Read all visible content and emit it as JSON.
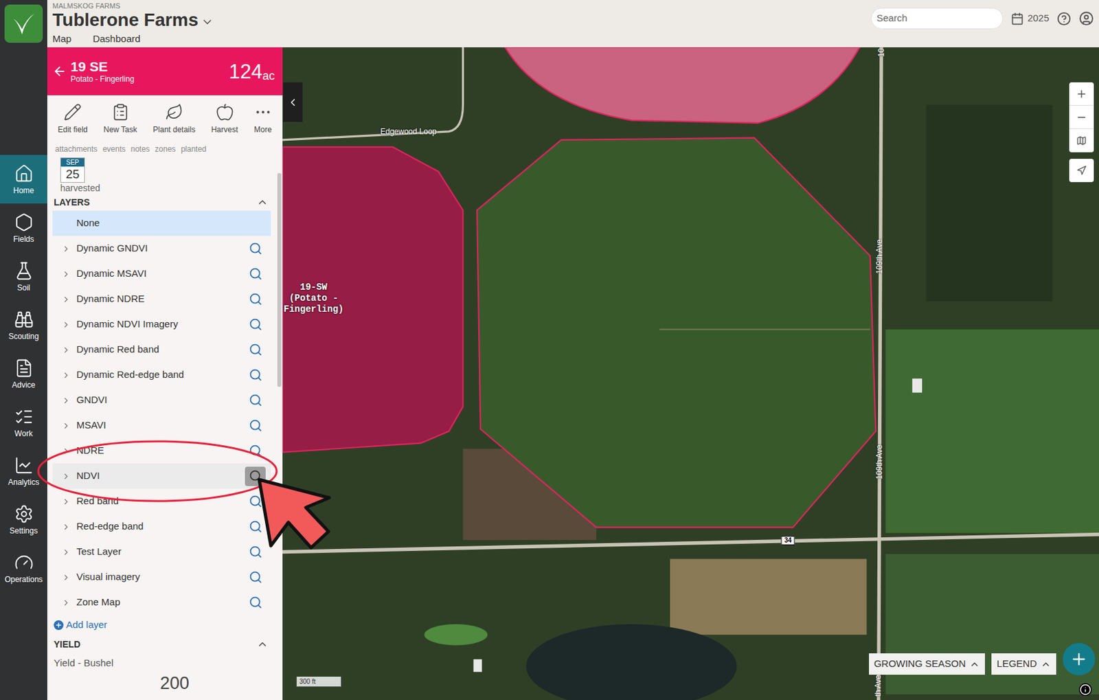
{
  "app": {
    "org": "MALMSKOG FARMS",
    "farm": "Tublerone Farms",
    "tabs": [
      {
        "label": "Map",
        "selected": true
      },
      {
        "label": "Dashboard",
        "selected": false
      }
    ],
    "search": {
      "placeholder": "Search"
    },
    "year": "2025"
  },
  "rail": [
    {
      "label": "Home",
      "selected": true
    },
    {
      "label": "Fields",
      "selected": false
    },
    {
      "label": "Soil",
      "selected": false
    },
    {
      "label": "Scouting",
      "selected": false
    },
    {
      "label": "Advice",
      "selected": false
    },
    {
      "label": "Work",
      "selected": false
    },
    {
      "label": "Analytics",
      "selected": false
    },
    {
      "label": "Settings",
      "selected": false
    },
    {
      "label": "Operations",
      "selected": false
    }
  ],
  "field": {
    "name": "19 SE",
    "crop": "Potato - Fingerling",
    "area": "124",
    "unit": "ac"
  },
  "toolbar": [
    "Edit field",
    "New Task",
    "Plant details",
    "Harvest",
    "More"
  ],
  "sub_tabs": [
    "attachments",
    "events",
    "notes",
    "zones",
    "planted"
  ],
  "harvest": {
    "month": "SEP",
    "day": "25",
    "label": "harvested"
  },
  "layers": {
    "title": "LAYERS",
    "expanded": true,
    "add": "Add layer",
    "items": [
      {
        "label": "None",
        "selected": true,
        "hovered": false,
        "kind": "none"
      },
      {
        "label": "Dynamic GNDVI",
        "selected": false,
        "hovered": false,
        "kind": "layer"
      },
      {
        "label": "Dynamic MSAVI",
        "selected": false,
        "hovered": false,
        "kind": "layer"
      },
      {
        "label": "Dynamic NDRE",
        "selected": false,
        "hovered": false,
        "kind": "layer"
      },
      {
        "label": "Dynamic NDVI Imagery",
        "selected": false,
        "hovered": false,
        "kind": "layer"
      },
      {
        "label": "Dynamic Red band",
        "selected": false,
        "hovered": false,
        "kind": "layer"
      },
      {
        "label": "Dynamic Red-edge band",
        "selected": false,
        "hovered": false,
        "kind": "layer"
      },
      {
        "label": "GNDVI",
        "selected": false,
        "hovered": false,
        "kind": "layer"
      },
      {
        "label": "MSAVI",
        "selected": false,
        "hovered": false,
        "kind": "layer"
      },
      {
        "label": "NDRE",
        "selected": false,
        "hovered": false,
        "kind": "layer"
      },
      {
        "label": "NDVI",
        "selected": false,
        "hovered": true,
        "kind": "layer"
      },
      {
        "label": "Red band",
        "selected": false,
        "hovered": false,
        "kind": "layer"
      },
      {
        "label": "Red-edge band",
        "selected": false,
        "hovered": false,
        "kind": "layer"
      },
      {
        "label": "Test Layer",
        "selected": false,
        "hovered": false,
        "kind": "layer"
      },
      {
        "label": "Visual imagery",
        "selected": false,
        "hovered": false,
        "kind": "layer"
      },
      {
        "label": "Zone Map",
        "selected": false,
        "hovered": false,
        "kind": "layer"
      }
    ]
  },
  "yield": {
    "title": "YIELD",
    "expanded": true,
    "label": "Yield - Bushel",
    "value": "200"
  },
  "map": {
    "field_label": [
      "19-SW",
      "(Potato -",
      "Fingerling)"
    ],
    "road_labels": [
      {
        "text": "Edgewood Loop",
        "kind": "horizontal"
      },
      {
        "text": "10",
        "kind": "vertical"
      },
      {
        "text": "109th Ave",
        "kind": "vertical"
      },
      {
        "text": "109th Ave",
        "kind": "vertical"
      },
      {
        "text": "th Ave",
        "kind": "vertical"
      },
      {
        "text": "34",
        "kind": "shield"
      }
    ],
    "scale": "300 ft",
    "buttons": [
      {
        "label": "GROWING SEASON",
        "expanded": false
      },
      {
        "label": "LEGEND",
        "expanded": false
      }
    ]
  }
}
